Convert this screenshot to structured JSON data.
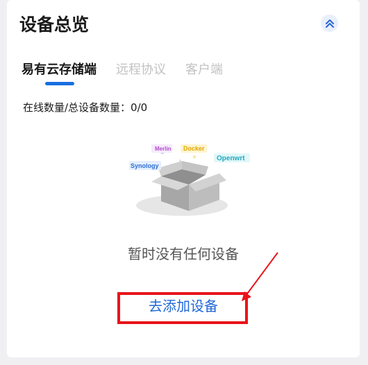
{
  "header": {
    "title": "设备总览",
    "collapse_icon": "double-chevron-up-icon"
  },
  "tabs": [
    {
      "label": "易有云存储端",
      "active": true
    },
    {
      "label": "远程协议",
      "active": false
    },
    {
      "label": "客户端",
      "active": false
    }
  ],
  "device_count": {
    "text": "在线数量/总设备数量：0/0"
  },
  "illustration": {
    "icon": "empty-box-icon",
    "tags": [
      "Merlin",
      "Docker",
      "Synology",
      "Openwrt"
    ]
  },
  "empty_state": {
    "message": "暂时没有任何设备",
    "add_link": "去添加设备"
  },
  "colors": {
    "accent": "#1a6fe0",
    "link": "#2068d8",
    "annotation": "#e8141a"
  }
}
